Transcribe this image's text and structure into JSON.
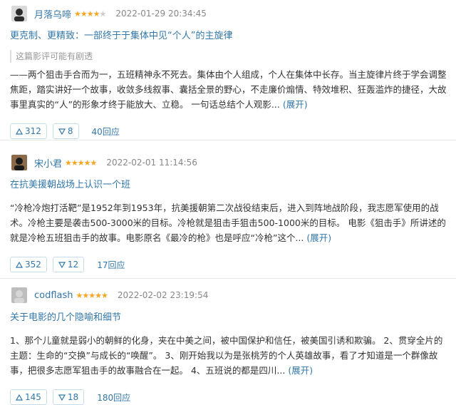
{
  "reviews": [
    {
      "username": "月落乌啼",
      "rating": 4,
      "time": "2022-01-29 20:34:45",
      "title": "更克制、更精致：一部终于于集体中见“个人”的主旋律",
      "spoiler": "这篇影评可能有剧透",
      "body": "——两个狙击手合而为一，五班精神永不死去。集体由个人组成，个人在集体中长存。当主旋律片终于学会调整焦距，踏实讲好一个故事，收敛多线叙事、囊括全景的野心，不走廉价煽情、特效堆积、狂轰滥炸的捷径，大故事里真实的“人”的形象才终于能放大、立稳。 一句话总结个人观影...",
      "expand": "(展开)",
      "useful": "312",
      "useless": "8",
      "replies": "40回应",
      "avatar_colors": [
        "#2b2b2b",
        "#d9d9d9"
      ]
    },
    {
      "username": "宋小君",
      "rating": 5,
      "time": "2022-02-01 11:14:56",
      "title": "在抗美援朝战场上认识一个班",
      "spoiler": "",
      "body": "“冷枪冷炮打活靶”是1952年到1953年，抗美援朝第二次战役结束后，进入到阵地战阶段，我志愿军使用的战术。冷枪主要是袭击500-3000米的目标。冷枪就是狙击手狙击500-1000米的目标。 电影《狙击手》所讲述的就是冷枪五班狙击手的故事。电影原名《最冷的枪》也是呼应“冷枪”这个...",
      "expand": "(展开)",
      "useful": "352",
      "useless": "12",
      "replies": "17回应",
      "avatar_colors": [
        "#1a1a1a",
        "#8a6a4a"
      ]
    },
    {
      "username": "codflash",
      "rating": 5,
      "time": "2022-02-02 23:19:54",
      "title": "关于电影的几个隐喻和细节",
      "spoiler": "",
      "body": "1、那个儿童就是弱小的朝鲜的化身，夹在中美之间，被中国保护和信任，被美国引诱和欺骗。 2、贯穿全片的主题：生命的“交换”与成长的“唤醒”。 3、刚开始我以为是张桃芳的个人英雄故事，看了才知道是一个群像故事，把很多志愿军狙击手的故事融合在一起。 4、五班说的都是四川...",
      "expand": "(展开)",
      "useful": "145",
      "useless": "18",
      "replies": "180回应",
      "avatar_colors": [
        "#d6d6d6",
        "#bdbdbd"
      ]
    }
  ],
  "icons": {
    "star": "★",
    "up": "up-triangle-icon",
    "down": "down-triangle-icon"
  },
  "colors": {
    "link": "#3377aa",
    "star": "#f5a623"
  }
}
